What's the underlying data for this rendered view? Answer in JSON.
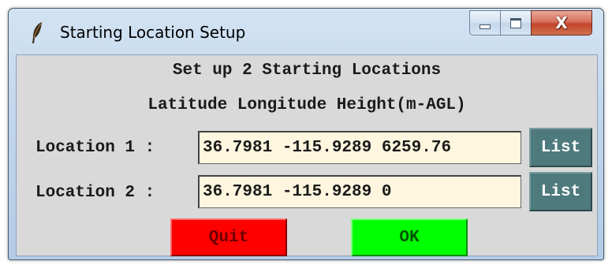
{
  "window": {
    "title": "Starting Location Setup",
    "icon": "feather-icon",
    "controls": [
      "minimize-icon",
      "maximize-icon",
      "close-icon"
    ],
    "close_symbol": "X"
  },
  "dialog": {
    "heading": "Set up 2 Starting Locations",
    "subheading": "Latitude Longitude Height(m-AGL)",
    "locations": [
      {
        "label": "Location 1 :",
        "value": "36.7981 -115.9289 6259.76",
        "list_label": "List"
      },
      {
        "label": "Location 2 :",
        "value": "36.7981 -115.9289 0",
        "list_label": "List"
      }
    ],
    "quit_label": "Quit",
    "ok_label": "OK"
  },
  "colors": {
    "client_bg": "#d9d9d9",
    "input_bg": "#fef6de",
    "list_button": "#4e7a7d",
    "quit_button": "#ff0000",
    "ok_button": "#00ff00",
    "close_button": "#c3452c"
  }
}
